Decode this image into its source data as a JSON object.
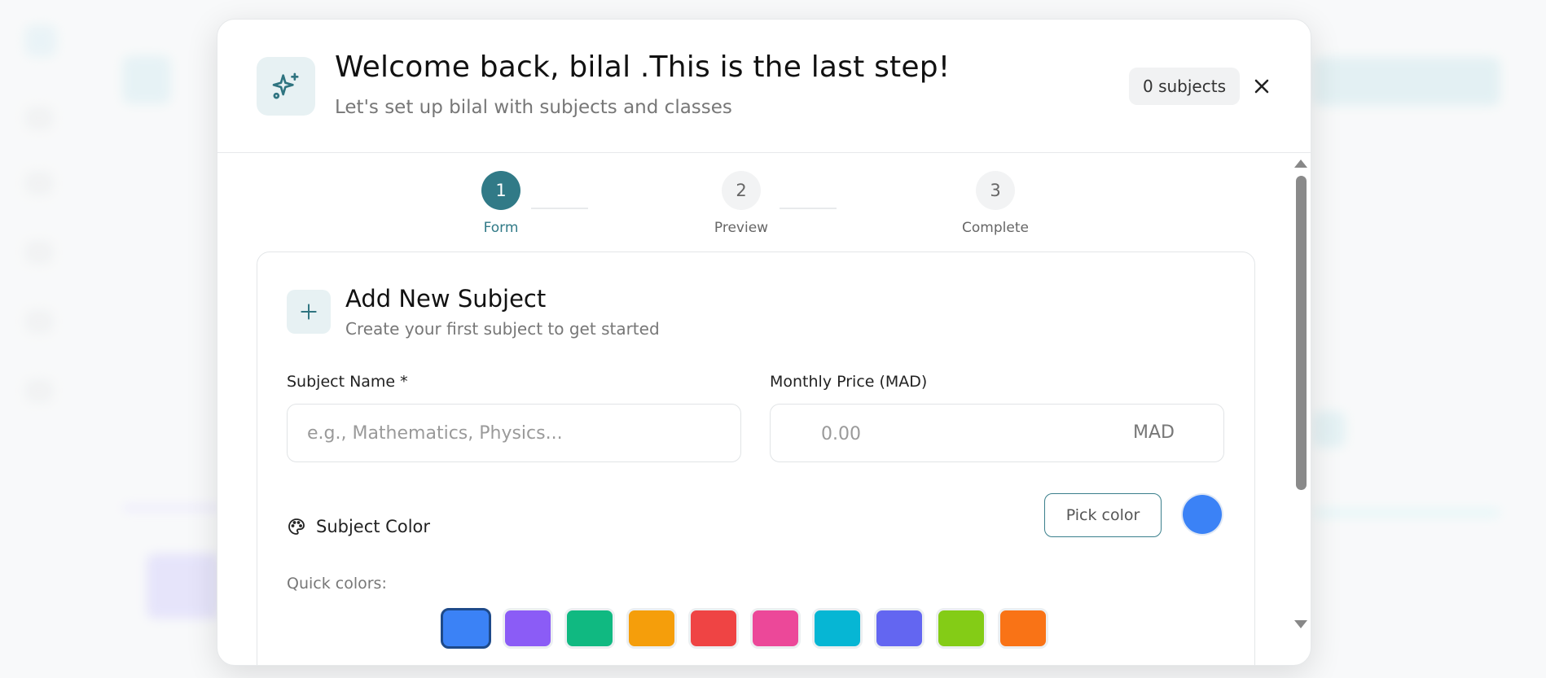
{
  "modal": {
    "title": "Welcome back, bilal .This is the last step!",
    "subtitle": "Let's set up bilal with subjects and classes",
    "subject_count": "0 subjects",
    "header_icon": "sparkles-icon",
    "close_icon": "close-icon"
  },
  "stepper": {
    "steps": [
      {
        "number": "1",
        "label": "Form",
        "state": "active"
      },
      {
        "number": "2",
        "label": "Preview",
        "state": "inactive"
      },
      {
        "number": "3",
        "label": "Complete",
        "state": "inactive"
      }
    ]
  },
  "form": {
    "title": "Add New Subject",
    "subtitle": "Create your first subject to get started",
    "subject_name_label": "Subject Name *",
    "subject_name_placeholder": "e.g., Mathematics, Physics...",
    "price_label": "Monthly Price (MAD)",
    "price_placeholder": "0.00",
    "price_unit": "MAD",
    "color_label": "Subject Color",
    "pick_color_label": "Pick color",
    "selected_color": "#3b82f6",
    "quick_colors_label": "Quick colors:",
    "quick_colors": [
      "#3b82f6",
      "#8b5cf6",
      "#10b981",
      "#f59e0b",
      "#ef4444",
      "#ec4899",
      "#06b6d4",
      "#6366f1",
      "#84cc16",
      "#f97316"
    ]
  },
  "colors": {
    "accent": "#317a87",
    "icon_bg": "#e7f1f3"
  }
}
